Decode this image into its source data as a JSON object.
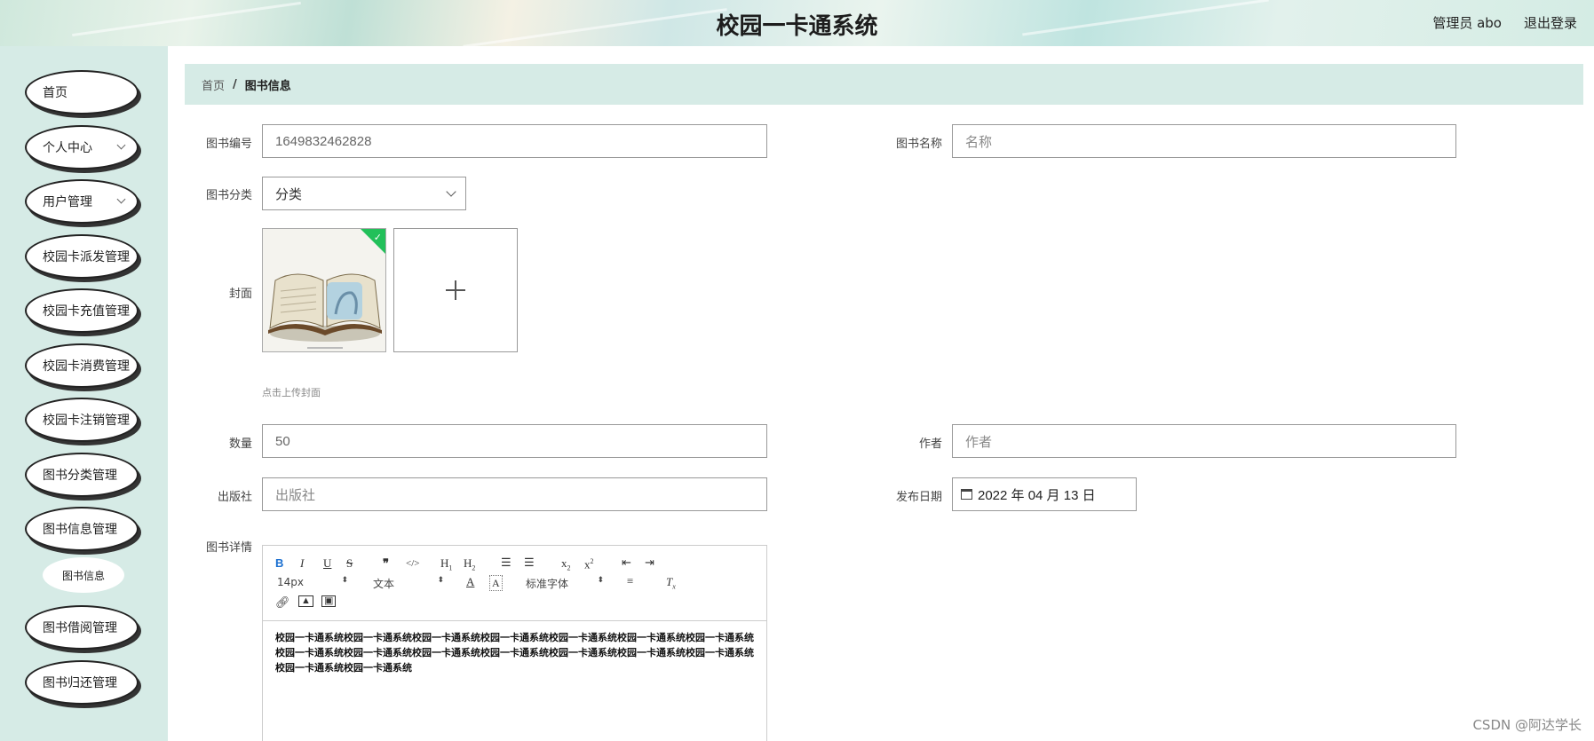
{
  "header": {
    "title": "校园一卡通系统",
    "user": "管理员 abo",
    "logout": "退出登录"
  },
  "sidebar": {
    "items": [
      {
        "label": "首页",
        "has_arrow": false
      },
      {
        "label": "个人中心",
        "has_arrow": true
      },
      {
        "label": "用户管理",
        "has_arrow": true
      },
      {
        "label": "校园卡派发管理",
        "has_arrow": false
      },
      {
        "label": "校园卡充值管理",
        "has_arrow": false
      },
      {
        "label": "校园卡消费管理",
        "has_arrow": false
      },
      {
        "label": "校园卡注销管理",
        "has_arrow": false
      },
      {
        "label": "图书分类管理",
        "has_arrow": false
      },
      {
        "label": "图书信息管理",
        "has_arrow": false
      },
      {
        "label": "图书借阅管理",
        "has_arrow": false
      },
      {
        "label": "图书归还管理",
        "has_arrow": false
      }
    ],
    "submenu": {
      "label": "图书信息"
    }
  },
  "breadcrumb": {
    "home": "首页",
    "separator": "/",
    "current": "图书信息"
  },
  "form": {
    "book_number": {
      "label": "图书编号",
      "value": "1649832462828"
    },
    "book_name": {
      "label": "图书名称",
      "placeholder": "名称"
    },
    "category": {
      "label": "图书分类",
      "placeholder": "分类"
    },
    "cover": {
      "label": "封面",
      "tip": "点击上传封面"
    },
    "quantity": {
      "label": "数量",
      "value": "50"
    },
    "author": {
      "label": "作者",
      "placeholder": "作者"
    },
    "publisher": {
      "label": "出版社",
      "placeholder": "出版社"
    },
    "publish_date": {
      "label": "发布日期",
      "value": "2022 年 04 月 13 日"
    },
    "details": {
      "label": "图书详情",
      "toolbar": {
        "font_size": "14px",
        "text_style": "文本",
        "font_family": "标准字体"
      },
      "content": "校园一卡通系统校园一卡通系统校园一卡通系统校园一卡通系统校园一卡通系统校园一卡通系统校园一卡通系统校园一卡通系统校园一卡通系统校园一卡通系统校园一卡通系统校园一卡通系统校园一卡通系统校园一卡通系统校园一卡通系统校园一卡通系统"
    }
  },
  "watermark": "CSDN @阿达学长",
  "colors": {
    "sidebar_bg": "#d6ebe6",
    "breadcrumb_bg": "#d6ebe6",
    "check_green": "#22c05a"
  }
}
